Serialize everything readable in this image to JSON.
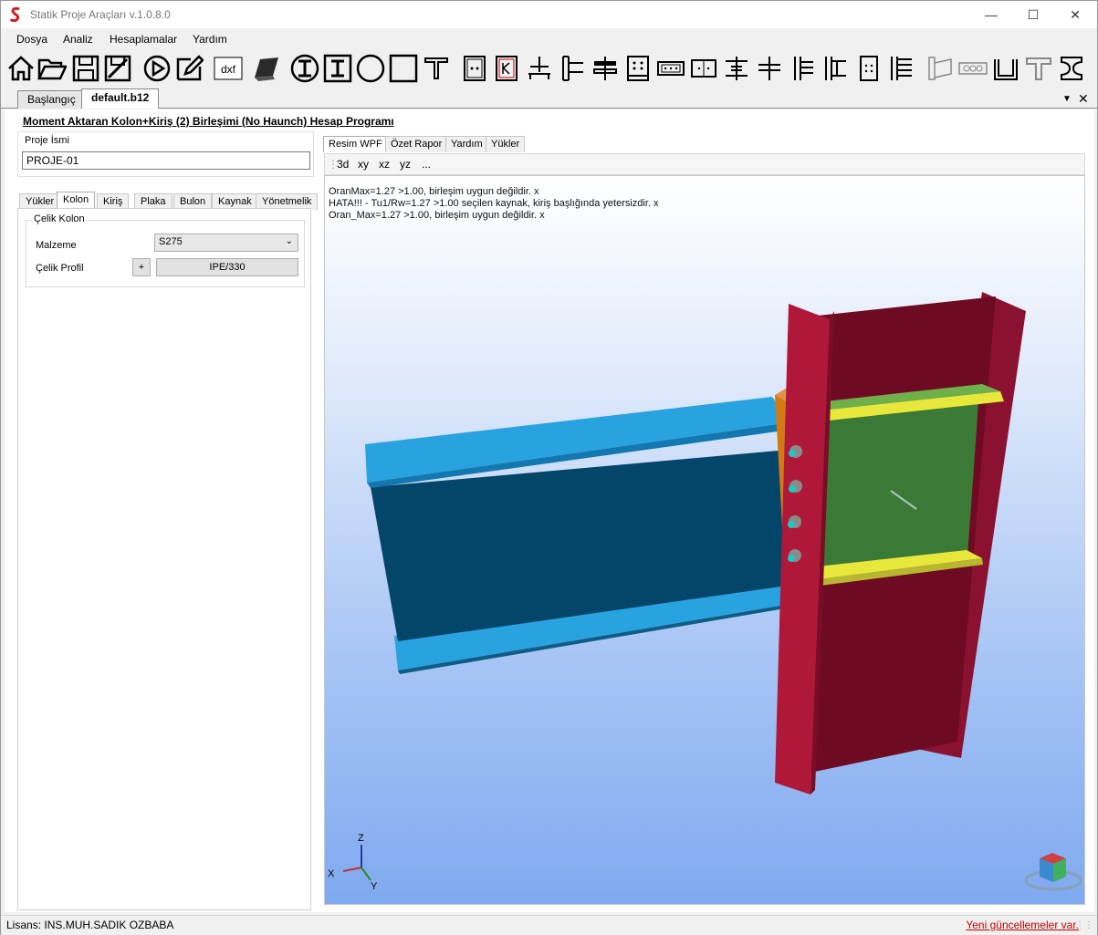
{
  "window": {
    "title": "Statik Proje Araçları v.1.0.8.0"
  },
  "menu": [
    "Dosya",
    "Analiz",
    "Hesaplamalar",
    "Yardım"
  ],
  "toolbar": [
    {
      "name": "home-icon"
    },
    {
      "name": "folder-open-icon"
    },
    {
      "name": "save-icon"
    },
    {
      "name": "save-as-icon"
    },
    {
      "name": "run-icon"
    },
    {
      "name": "edit-icon"
    },
    {
      "name": "dxf-icon",
      "label": "dxf"
    },
    {
      "name": "3d-box-icon"
    },
    {
      "name": "i-circle-icon"
    },
    {
      "name": "i-square-icon"
    },
    {
      "name": "circle-icon"
    },
    {
      "name": "square-icon"
    },
    {
      "name": "t-section-icon"
    },
    {
      "name": "column-base-icon"
    },
    {
      "name": "k-box-icon"
    },
    {
      "name": "beam-column-icon"
    },
    {
      "name": "connection-1-icon"
    },
    {
      "name": "connection-2-icon"
    },
    {
      "name": "bolted-plate-icon"
    },
    {
      "name": "splice-1-icon"
    },
    {
      "name": "splice-2-icon"
    },
    {
      "name": "connection-3-icon"
    },
    {
      "name": "connection-4-icon"
    },
    {
      "name": "connection-5-icon"
    },
    {
      "name": "connection-6-icon"
    },
    {
      "name": "connection-7-icon"
    },
    {
      "name": "connection-8-icon"
    },
    {
      "name": "haunch-icon"
    },
    {
      "name": "bolt-row-icon"
    },
    {
      "name": "u-channel-icon"
    },
    {
      "name": "tee-icon"
    },
    {
      "name": "i-beam-icon"
    }
  ],
  "doc_tabs": [
    "Başlangıç",
    "default.b12"
  ],
  "program_title": "Moment Aktaran Kolon+Kiriş (2) Birleşimi (No Haunch) Hesap Programı",
  "project": {
    "label": "Proje İsmi",
    "value": "PROJE-01"
  },
  "left_tabs": [
    "Yükler",
    "Kolon",
    "Kiriş",
    "Plaka",
    "Bulon",
    "Kaynak",
    "Yönetmelik"
  ],
  "kolon": {
    "group_label": "Çelik Kolon",
    "material_label": "Malzeme",
    "material_value": "S275",
    "profile_label": "Çelik Profil",
    "plus_label": "+",
    "profile_value": "IPE/330"
  },
  "right_tabs": [
    "Resim WPF",
    "Özet Rapor",
    "Yardım",
    "Yükler"
  ],
  "view_buttons": [
    "3d",
    "xy",
    "xz",
    "yz",
    "..."
  ],
  "messages": [
    "OranMax=1.27 >1.00, birleşim uygun değildir. x",
    "HATA!!! - Tu1/Rw=1.27 >1.00 seçilen kaynak, kiriş başlığında yetersizdir. x",
    "Oran_Max=1.27 >1.00, birleşim uygun değildir. x"
  ],
  "axes": {
    "z": "Z",
    "x": "X",
    "y": "Y"
  },
  "colors": {
    "column": "#b0183a",
    "beam_flange": "#29a3e0",
    "beam_web": "#04456a",
    "end_plate": "#c86a10",
    "stiffener": "#e8e83c",
    "panel": "#3a7a3a",
    "bolt": "#7a7a7a"
  },
  "status": {
    "license": "Lisans: INS.MUH.SADIK OZBABA",
    "update": "Yeni güncellemeler var."
  }
}
